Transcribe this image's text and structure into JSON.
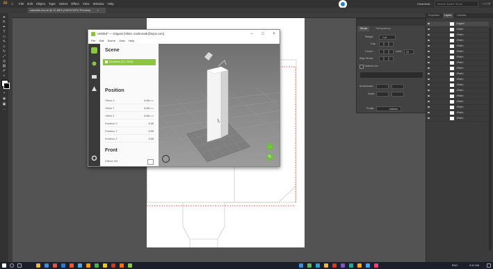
{
  "menubar": {
    "logo": "Ai",
    "items": [
      "File",
      "Edit",
      "Object",
      "Type",
      "Select",
      "Effect",
      "View",
      "Window",
      "Help"
    ],
    "workspace": "Essentials",
    "search_placeholder": "Search Adobe Stock"
  },
  "document_tab": {
    "label": "cassette-box.ai @ 12.88% (CMYK/GPU Preview)",
    "close": "×"
  },
  "origami": {
    "title": "Untitled* — Origami [Viktor, marknovak@mpix.com]",
    "menu": [
      "File",
      "Edit",
      "Scene",
      "View",
      "Help"
    ],
    "scene_heading": "Scene",
    "scene_item": "Rechteck (CC 2019)",
    "position_heading": "Position",
    "position_rows": [
      {
        "label": "Offset X",
        "value": "0.00",
        "unit": "mm"
      },
      {
        "label": "Offset Y",
        "value": "0.00",
        "unit": "mm"
      },
      {
        "label": "Offset Z",
        "value": "0.00",
        "unit": "mm"
      },
      {
        "label": "Rotation X",
        "value": "0.00",
        "unit": ""
      },
      {
        "label": "Rotation Y",
        "value": "0.00",
        "unit": ""
      },
      {
        "label": "Rotation Z",
        "value": "0.00",
        "unit": ""
      }
    ],
    "front_heading": "Front",
    "front_row": "Diffuse tint",
    "window_buttons": {
      "minimize": "–",
      "maximize": "□",
      "close": "×"
    }
  },
  "properties_panel": {
    "tabs": [
      "Stroke",
      "Transparency"
    ],
    "weight_label": "Weight:",
    "weight_value": "1 pt",
    "cap_label": "Cap:",
    "corner_label": "Corner:",
    "limit_label": "Limit:",
    "limit_value": "10",
    "align_stroke_label": "Align Stroke:",
    "dashed_line_label": "Dashed Line",
    "arrowheads_label": "Arrowheads:",
    "scale_label": "Scale:",
    "profile_label": "Profile:",
    "profile_value": "Uniform"
  },
  "layers_panel": {
    "tabs": [
      "Properties",
      "Layers",
      "Libraries"
    ],
    "rows": [
      "Origami",
      "<Path>",
      "<Path>",
      "<Path>",
      "<Path>",
      "<Path>",
      "<Path>",
      "<Path>",
      "<Path>",
      "<Path>",
      "<Path>",
      "<Path>",
      "<Path>",
      "<Path>",
      "<Path>",
      "<Path>",
      "<Path>",
      "<Path>"
    ]
  },
  "taskbar": {
    "time": "9:31 AM",
    "lang": "ENG"
  },
  "colors": {
    "accent_green": "#8cc63f",
    "ai_orange": "#ff9a00",
    "dieline_red": "#e0452f"
  }
}
